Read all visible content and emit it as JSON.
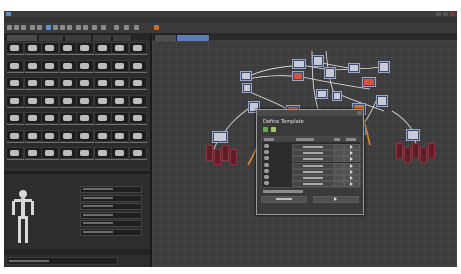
{
  "dialog": {
    "title": "Define Template"
  },
  "colors": {
    "background": "#2a2a2a",
    "panel": "#303030",
    "canvas": "#3d3d3d",
    "accent_blue": "#5b7fb2",
    "node_blue": "#3e4a6e",
    "node_red": "#d9523e",
    "node_orange": "#e07a2e",
    "wire_orange": "#d98a3a",
    "wire_white": "#e8e8e8",
    "selected_tab": "#5b7fb2"
  },
  "icons": {
    "app": "app-icon",
    "window_controls": [
      "minimize-icon",
      "maximize-icon",
      "close-icon"
    ],
    "toolbar": [
      "new-file-icon",
      "open-icon",
      "save-icon",
      "undo-icon",
      "redo-icon",
      "select-icon",
      "move-icon",
      "rotate-icon",
      "scale-icon",
      "snap-icon",
      "frame-icon",
      "render-icon"
    ],
    "dialog_toolbar": [
      "add-template-icon",
      "refresh-icon"
    ]
  }
}
